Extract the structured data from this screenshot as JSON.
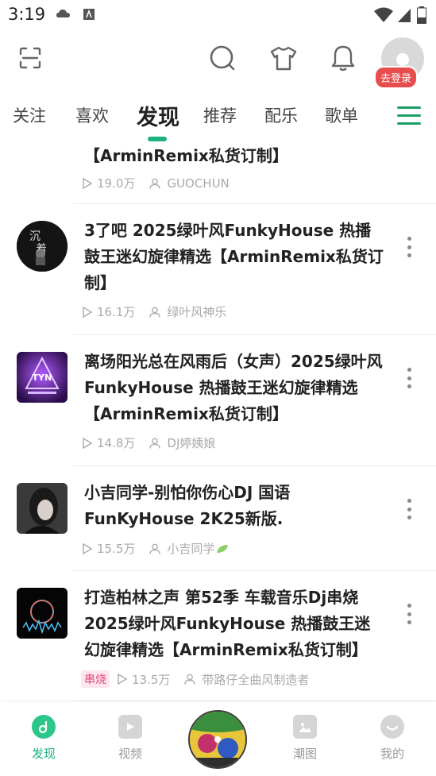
{
  "status_bar": {
    "time": "3:19",
    "left_icons": [
      "cloud-icon",
      "app-a-icon"
    ],
    "right_icons": [
      "wifi-icon",
      "signal-icon",
      "battery-icon"
    ]
  },
  "top_bar": {
    "icons": [
      "scan-icon",
      "search-icon",
      "shirt-icon",
      "bell-icon"
    ],
    "login_badge": "去登录"
  },
  "tabs": {
    "items": [
      "关注",
      "喜欢",
      "发现",
      "推荐",
      "配乐",
      "歌单"
    ],
    "active": "发现"
  },
  "feed": {
    "partial_item": {
      "title": "【ArminRemix私货订制】",
      "plays": "19.0万",
      "author": "GUOCHUN"
    },
    "items": [
      {
        "title": "3了吧 2025绿叶风FunkyHouse 热播鼓王迷幻旋律精选【ArminRemix私货订制】",
        "plays": "16.1万",
        "author": "绿叶风神乐",
        "tag": ""
      },
      {
        "title": "离场阳光总在风雨后（女声）2025绿叶风FunkyHouse 热播鼓王迷幻旋律精选【ArminRemix私货订制】",
        "plays": "14.8万",
        "author": "DJ婷姨娘",
        "tag": "",
        "thumb_text": "TYN"
      },
      {
        "title": "小吉同学-别怕你伤心DJ 国语FunKyHouse 2K25新版.",
        "plays": "15.5万",
        "author": "小吉同学",
        "tag": ""
      },
      {
        "title": "打造柏林之声 第52季 车载音乐Dj串烧2025绿叶风FunkyHouse 热播鼓王迷幻旋律精选【ArminRemix私货订制】",
        "plays": "13.5万",
        "author": "带路仔全曲风制造者",
        "tag": "串烧"
      }
    ]
  },
  "bottom_nav": {
    "items": [
      {
        "label": "发现",
        "icon": "discover-icon"
      },
      {
        "label": "视频",
        "icon": "video-icon"
      },
      {
        "label": "潮图",
        "icon": "image-icon"
      },
      {
        "label": "我的",
        "icon": "profile-icon"
      }
    ]
  },
  "colors": {
    "accent": "#1db27e",
    "badge": "#e84d4d",
    "tag_text": "#e0467c",
    "meta_text": "#aaaaaa"
  }
}
